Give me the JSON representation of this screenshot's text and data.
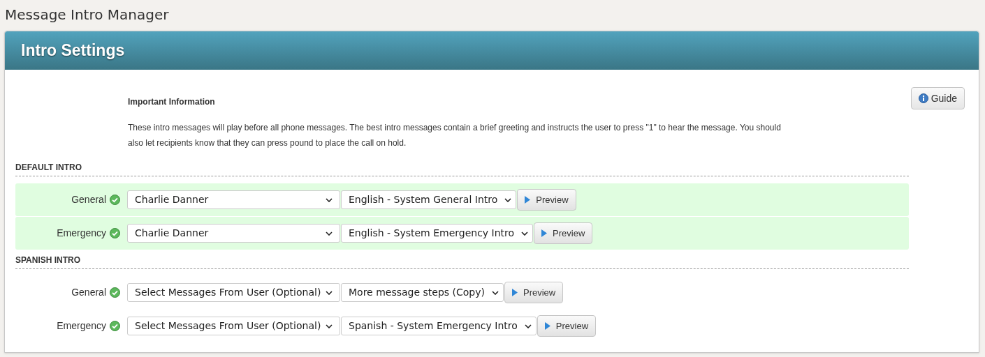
{
  "page_title": "Message Intro Manager",
  "panel": {
    "title": "Intro Settings",
    "info": {
      "heading": "Important Information",
      "text": "These intro messages will play before all phone messages. The best intro messages contain a brief greeting and instructs the user to press \"1\" to hear the message. You should also let recipients know that they can press pound to place the call on hold."
    },
    "guide_button": "Guide",
    "sections": [
      {
        "title": "DEFAULT INTRO",
        "rows": [
          {
            "label": "General",
            "highlighted": true,
            "user_select": "Charlie Danner",
            "message_select": "English - System General Intro",
            "preview_button": "Preview"
          },
          {
            "label": "Emergency",
            "highlighted": true,
            "user_select": "Charlie Danner",
            "message_select": "English - System Emergency Intro",
            "preview_button": "Preview"
          }
        ]
      },
      {
        "title": "SPANISH INTRO",
        "rows": [
          {
            "label": "General",
            "highlighted": false,
            "user_select": "Select Messages From User (Optional)",
            "message_select": "More message steps (Copy)",
            "preview_button": "Preview"
          },
          {
            "label": "Emergency",
            "highlighted": false,
            "user_select": "Select Messages From User (Optional)",
            "message_select": "Spanish - System Emergency Intro",
            "preview_button": "Preview"
          }
        ]
      }
    ]
  }
}
